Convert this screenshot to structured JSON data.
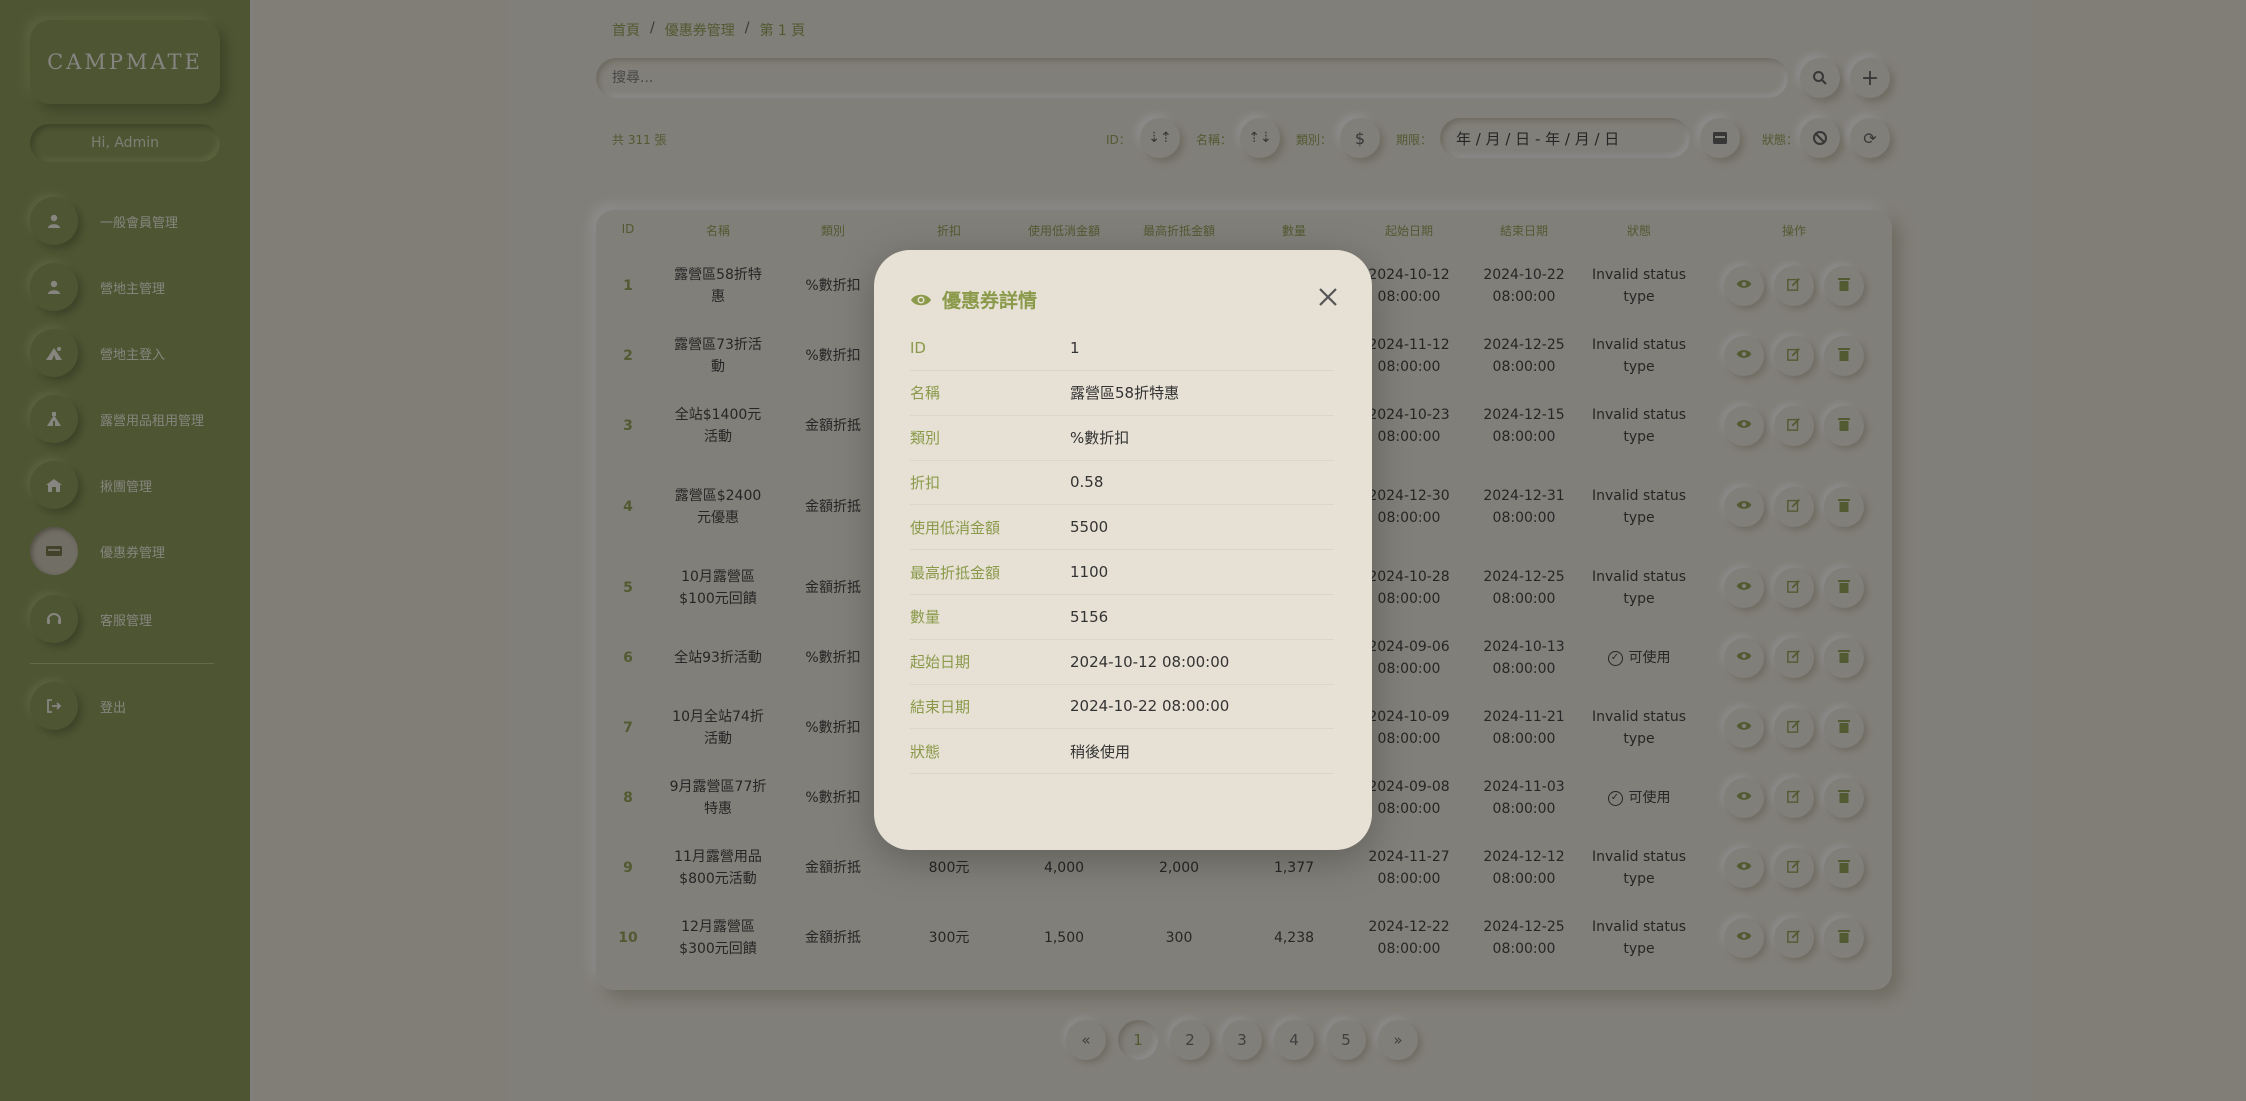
{
  "sidebar": {
    "logo": "CAMPMATE",
    "greeting": "Hi, Admin",
    "items": [
      {
        "label": "一般會員管理",
        "icon": "user-icon"
      },
      {
        "label": "營地主管理",
        "icon": "user-icon"
      },
      {
        "label": "營地主登入",
        "icon": "tent-icon"
      },
      {
        "label": "露營用品租用管理",
        "icon": "camping-gear-icon"
      },
      {
        "label": "揪團管理",
        "icon": "group-camp-icon"
      },
      {
        "label": "優惠券管理",
        "icon": "coupon-icon"
      },
      {
        "label": "客服管理",
        "icon": "headset-icon"
      }
    ],
    "logout": "登出"
  },
  "breadcrumb": [
    "首頁",
    "優惠券管理",
    "第 1 頁"
  ],
  "search": {
    "placeholder": "搜尋..."
  },
  "toolbar": {
    "total": "共 311 張",
    "filters": {
      "id": "ID：",
      "name": "名稱：",
      "type": "類別：",
      "period": "期限：",
      "status": "狀態："
    },
    "date_range_placeholder": "年 / 月 / 日 - 年 / 月 / 日"
  },
  "table": {
    "headers": [
      "ID",
      "名稱",
      "類別",
      "折扣",
      "使用低消金額",
      "最高折抵金額",
      "數量",
      "起始日期",
      "結束日期",
      "狀態",
      "操作"
    ],
    "rows": [
      {
        "id": "1",
        "name": "露營區58折特惠",
        "type": "%數折扣",
        "discount": "",
        "min": "",
        "max": "",
        "qty": "",
        "start": "2024-10-12 08:00:00",
        "end": "2024-10-22 08:00:00",
        "status": "Invalid status type"
      },
      {
        "id": "2",
        "name": "露營區73折活動",
        "type": "%數折扣",
        "discount": "",
        "min": "",
        "max": "",
        "qty": "",
        "start": "2024-11-12 08:00:00",
        "end": "2024-12-25 08:00:00",
        "status": "Invalid status type"
      },
      {
        "id": "3",
        "name": "全站$1400元活動",
        "type": "金額折抵",
        "discount": "",
        "min": "",
        "max": "",
        "qty": "",
        "start": "2024-10-23 08:00:00",
        "end": "2024-12-15 08:00:00",
        "status": "Invalid status type"
      },
      {
        "id": "4",
        "name": "露營區$2400元優惠",
        "type": "金額折抵",
        "discount": "",
        "min": "",
        "max": "",
        "qty": "",
        "start": "2024-12-30 08:00:00",
        "end": "2024-12-31 08:00:00",
        "status": "Invalid status type"
      },
      {
        "id": "5",
        "name": "10月露營區$100元回饋",
        "type": "金額折抵",
        "discount": "",
        "min": "",
        "max": "",
        "qty": "",
        "start": "2024-10-28 08:00:00",
        "end": "2024-12-25 08:00:00",
        "status": "Invalid status type"
      },
      {
        "id": "6",
        "name": "全站93折活動",
        "type": "%數折扣",
        "discount": "",
        "min": "",
        "max": "",
        "qty": "",
        "start": "2024-09-06 08:00:00",
        "end": "2024-10-13 08:00:00",
        "status": "可使用"
      },
      {
        "id": "7",
        "name": "10月全站74折活動",
        "type": "%數折扣",
        "discount": "",
        "min": "",
        "max": "",
        "qty": "",
        "start": "2024-10-09 08:00:00",
        "end": "2024-11-21 08:00:00",
        "status": "Invalid status type"
      },
      {
        "id": "8",
        "name": "9月露營區77折特惠",
        "type": "%數折扣",
        "discount": "",
        "min": "",
        "max": "",
        "qty": "",
        "start": "2024-09-08 08:00:00",
        "end": "2024-11-03 08:00:00",
        "status": "可使用"
      },
      {
        "id": "9",
        "name": "11月露營用品$800元活動",
        "type": "金額折抵",
        "discount": "800元",
        "min": "4,000",
        "max": "2,000",
        "qty": "1,377",
        "start": "2024-11-27 08:00:00",
        "end": "2024-12-12 08:00:00",
        "status": "Invalid status type"
      },
      {
        "id": "10",
        "name": "12月露營區$300元回饋",
        "type": "金額折抵",
        "discount": "300元",
        "min": "1,500",
        "max": "300",
        "qty": "4,238",
        "start": "2024-12-22 08:00:00",
        "end": "2024-12-25 08:00:00",
        "status": "Invalid status type"
      }
    ]
  },
  "pagination": {
    "prev": "«",
    "pages": [
      "1",
      "2",
      "3",
      "4",
      "5"
    ],
    "next": "»",
    "current": "1"
  },
  "modal": {
    "title": "優惠券詳情",
    "fields": [
      {
        "label": "ID",
        "value": "1"
      },
      {
        "label": "名稱",
        "value": "露營區58折特惠"
      },
      {
        "label": "類別",
        "value": "%數折扣"
      },
      {
        "label": "折扣",
        "value": "0.58"
      },
      {
        "label": "使用低消金額",
        "value": "5500"
      },
      {
        "label": "最高折抵金額",
        "value": "1100"
      },
      {
        "label": "數量",
        "value": "5156"
      },
      {
        "label": "起始日期",
        "value": "2024-10-12 08:00:00"
      },
      {
        "label": "結束日期",
        "value": "2024-10-22 08:00:00"
      },
      {
        "label": "狀態",
        "value": "稍後使用"
      }
    ]
  },
  "colors": {
    "accent": "#8a9a4a",
    "sidebar": "#83914d",
    "background": "#e9e4d8",
    "modal": "#e7e1d5"
  }
}
